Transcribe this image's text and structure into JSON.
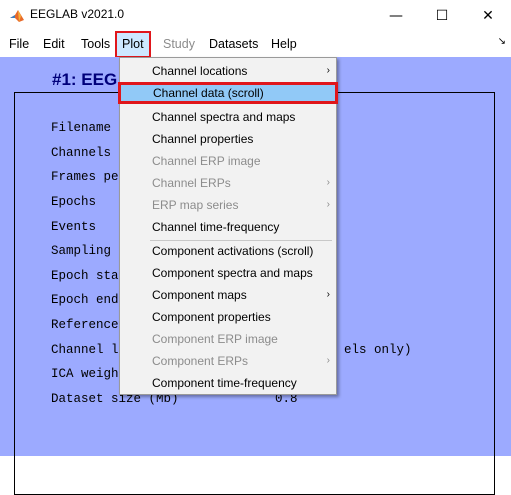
{
  "window": {
    "title": "EEGLAB v2021.0",
    "controls": {
      "minimize": "—",
      "maximize": "☐",
      "close": "✕"
    }
  },
  "menubar": {
    "items": [
      {
        "label": "File",
        "enabled": true
      },
      {
        "label": "Edit",
        "enabled": true
      },
      {
        "label": "Tools",
        "enabled": true
      },
      {
        "label": "Plot",
        "enabled": true,
        "active": true
      },
      {
        "label": "Study",
        "enabled": false
      },
      {
        "label": "Datasets",
        "enabled": true
      },
      {
        "label": "Help",
        "enabled": true
      }
    ],
    "dock_glyph": "↘"
  },
  "panel": {
    "title": "#1: EEG",
    "rows": [
      {
        "label": "Filename",
        "value": ""
      },
      {
        "label": "Channels",
        "value": ""
      },
      {
        "label": "Frames pe",
        "value": ""
      },
      {
        "label": "Epochs",
        "value": ""
      },
      {
        "label": "Events",
        "value": ""
      },
      {
        "label": "Sampling",
        "value": ""
      },
      {
        "label": "Epoch sta",
        "value": ""
      },
      {
        "label": "Epoch end",
        "value": ""
      },
      {
        "label": "Reference",
        "value": ""
      },
      {
        "label": "Channel l",
        "value": "els only)"
      },
      {
        "label": "ICA weigh",
        "value": ""
      },
      {
        "label": "Dataset size (Mb)",
        "value": "0.8"
      }
    ]
  },
  "plot_menu": {
    "items": [
      {
        "label": "Channel locations",
        "enabled": true,
        "submenu": true
      },
      {
        "label": "Channel data (scroll)",
        "enabled": true,
        "submenu": false,
        "highlighted": true
      },
      {
        "label": "Channel spectra and maps",
        "enabled": true,
        "submenu": false
      },
      {
        "label": "Channel properties",
        "enabled": true,
        "submenu": false
      },
      {
        "label": "Channel ERP image",
        "enabled": false,
        "submenu": false
      },
      {
        "label": "Channel ERPs",
        "enabled": false,
        "submenu": true
      },
      {
        "label": "ERP map series",
        "enabled": false,
        "submenu": true
      },
      {
        "label": "Channel time-frequency",
        "enabled": true,
        "submenu": false
      },
      {
        "label": "Component activations (scroll)",
        "enabled": true,
        "submenu": false
      },
      {
        "label": "Component spectra and maps",
        "enabled": true,
        "submenu": false
      },
      {
        "label": "Component maps",
        "enabled": true,
        "submenu": true
      },
      {
        "label": "Component properties",
        "enabled": true,
        "submenu": false
      },
      {
        "label": "Component ERP image",
        "enabled": false,
        "submenu": false
      },
      {
        "label": "Component ERPs",
        "enabled": false,
        "submenu": true
      },
      {
        "label": "Component time-frequency",
        "enabled": true,
        "submenu": false
      }
    ],
    "submenu_glyph": "›"
  },
  "colors": {
    "background": "#9caaff",
    "highlight": "#91c9f7",
    "annotation_box": "#e0161b",
    "title_text": "#00007a"
  }
}
